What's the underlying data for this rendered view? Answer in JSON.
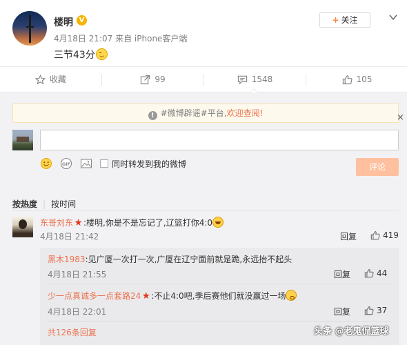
{
  "post": {
    "author": "楼明",
    "verified_badge": "V",
    "meta": "4月18日 21:07 来自 iPhone客户端",
    "text": "三节43分",
    "follow_label": "关注",
    "follow_plus": "+"
  },
  "actions": {
    "favorite": "收藏",
    "repost_count": "99",
    "comment_count": "1548",
    "like_count": "105"
  },
  "comment_box": {
    "notice_prefix": "#微博辟谣#平台,",
    "notice_link": "欢迎查阅!",
    "notice_close": "×",
    "repost_checkbox_label": "同时转发到我的微博",
    "submit_label": "评论"
  },
  "sort": {
    "hot": "按热度",
    "time": "按时间"
  },
  "comments": [
    {
      "user": "东哥刘东",
      "text": ":楼明,你是不是忘记了,辽篮打你4:0",
      "time": "4月18日 21:42",
      "reply_label": "回复",
      "likes": "419",
      "replies": [
        {
          "user": "黑木1983",
          "text": ":见广厦一次打一次,广厦在辽宁面前就是跪,永远抬不起头",
          "time": "4月18日 21:55",
          "reply_label": "回复",
          "likes": "44"
        },
        {
          "user": "少一点真诚多一点套路24",
          "text": ":不止4:0吧,季后赛他们就没赢过一场",
          "time": "4月18日 22:01",
          "reply_label": "回复",
          "likes": "37"
        }
      ],
      "more_replies": "共126条回复"
    }
  ],
  "watermark": "头条 @老鬼侃篮球",
  "colors": {
    "accent": "#eb7350",
    "muted": "#808080",
    "submit_disabled": "#ffc09f",
    "badge": "#f5b400"
  }
}
